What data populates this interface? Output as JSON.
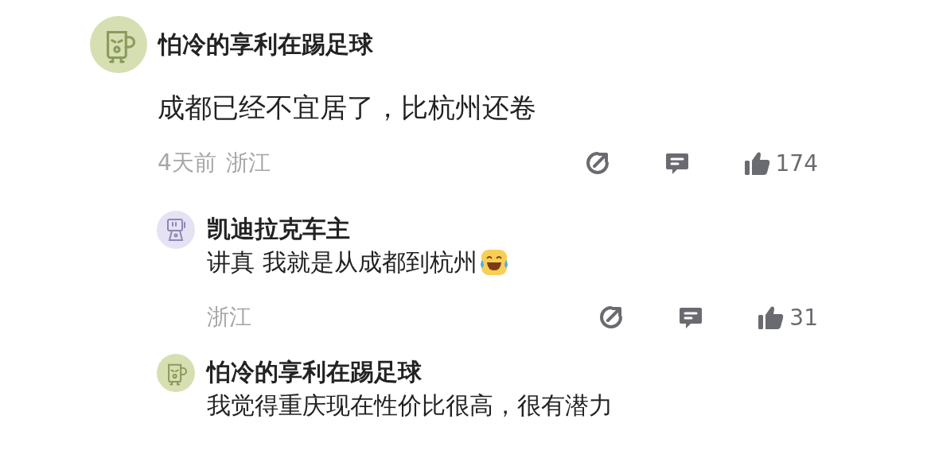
{
  "comment": {
    "author": "怕冷的享利在踢足球",
    "avatar": {
      "kind": "mug"
    },
    "text": "成都已经不宜居了，比杭州还卷",
    "time": "4天前",
    "location": "浙江",
    "likes": "174",
    "replies": [
      {
        "author": "凯迪拉克车主",
        "avatar": {
          "kind": "robot"
        },
        "text": "讲真 我就是从成都到杭州",
        "emoji": {
          "kind": "tears-of-joy"
        },
        "location": "浙江",
        "likes": "31"
      },
      {
        "author": "怕冷的享利在踢足球",
        "avatar": {
          "kind": "mug"
        },
        "text": "我觉得重庆现在性价比很高，很有潜力"
      }
    ]
  }
}
